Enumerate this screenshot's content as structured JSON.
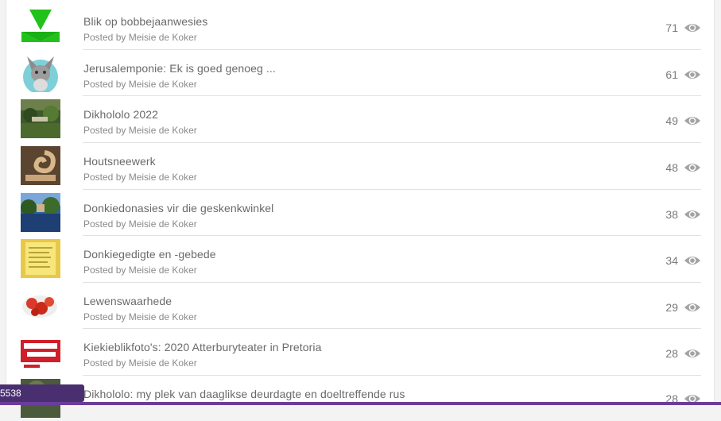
{
  "posts": [
    {
      "title": "Blik op bobbejaanwesies",
      "meta": "Posted by Meisie de Koker",
      "views": "71",
      "thumb": "green-arrow"
    },
    {
      "title": "Jerusalemponie: Ek is goed genoeg ...",
      "meta": "Posted by Meisie de Koker",
      "views": "61",
      "thumb": "donkey-avatar"
    },
    {
      "title": "Dikhololo 2022",
      "meta": "Posted by Meisie de Koker",
      "views": "49",
      "thumb": "garden-photo"
    },
    {
      "title": "Houtsneewerk",
      "meta": "Posted by Meisie de Koker",
      "views": "48",
      "thumb": "woodcarving-photo"
    },
    {
      "title": "Donkiedonasies vir die geskenkwinkel",
      "meta": "Posted by Meisie de Koker",
      "views": "38",
      "thumb": "lake-photo"
    },
    {
      "title": "Donkiegedigte en -gebede",
      "meta": "Posted by Meisie de Koker",
      "views": "34",
      "thumb": "poem-photo"
    },
    {
      "title": "Lewenswaarhede",
      "meta": "Posted by Meisie de Koker",
      "views": "29",
      "thumb": "strawberries-photo"
    },
    {
      "title": "Kiekieblikfoto's: 2020 Atterburyteater in Pretoria",
      "meta": "Posted by Meisie de Koker",
      "views": "28",
      "thumb": "theatre-poster-photo"
    },
    {
      "title": "Dikhololo: my plek van daaglikse deurdagte en doeltreffende rus",
      "meta": "",
      "views": "28",
      "thumb": "dikhololo-photo"
    }
  ],
  "view_icon": "eye-icon",
  "floating_badge": "5538",
  "colors": {
    "accent_bar": "#6a3d9a",
    "badge_bg": "#4a2f70",
    "eye": "#9a9a9a"
  }
}
